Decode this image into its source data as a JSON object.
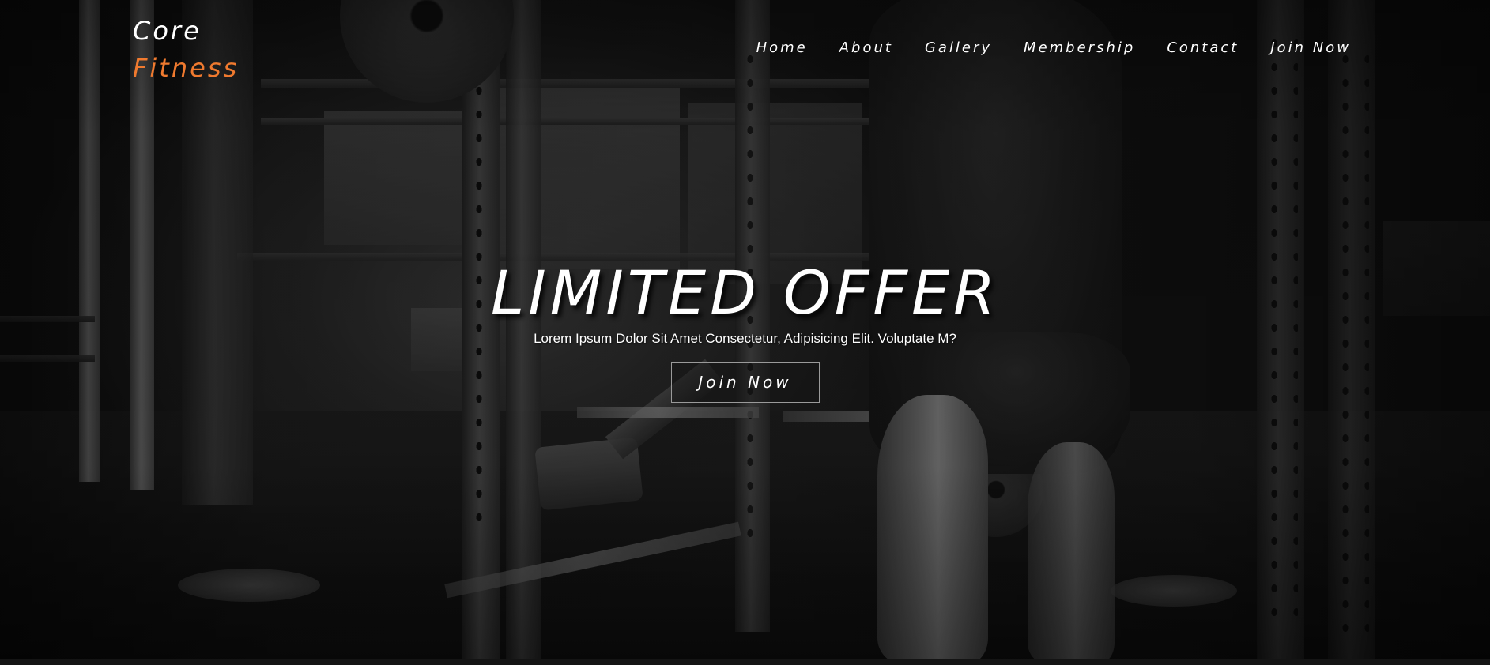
{
  "brand": {
    "line1": "Core",
    "line2": "Fitness",
    "accent_color": "#f07a2f"
  },
  "nav": {
    "items": [
      {
        "label": "Home"
      },
      {
        "label": "About"
      },
      {
        "label": "Gallery"
      },
      {
        "label": "Membership"
      },
      {
        "label": "Contact"
      },
      {
        "label": "Join Now"
      }
    ]
  },
  "hero": {
    "title": "LIMITED OFFER",
    "subtitle": "Lorem Ipsum Dolor Sit Amet Consectetur, Adipisicing Elit. Voluptate M?",
    "button_label": "Join Now"
  },
  "theme": {
    "text_color": "#ffffff",
    "button_border": "#9a9a9a",
    "background": "#0b0b0b"
  }
}
